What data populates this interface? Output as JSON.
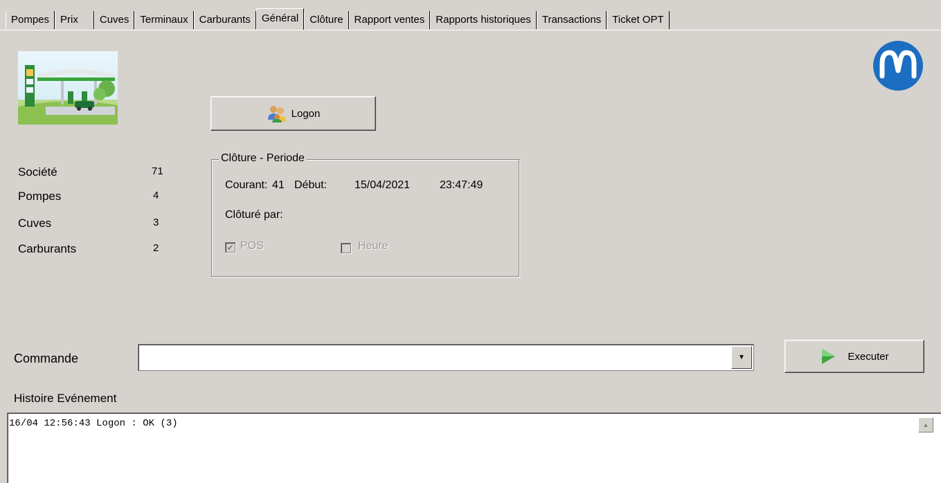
{
  "tabs": [
    {
      "label": "Pompes"
    },
    {
      "label": "Prix"
    },
    {
      "label": "Cuves"
    },
    {
      "label": "Terminaux"
    },
    {
      "label": "Carburants"
    },
    {
      "label": "Général",
      "active": true
    },
    {
      "label": "Clôture"
    },
    {
      "label": "Rapport ventes"
    },
    {
      "label": "Rapports historiques"
    },
    {
      "label": "Transactions"
    },
    {
      "label": "Ticket OPT"
    }
  ],
  "logon_label": "Logon",
  "stats": {
    "societe": {
      "label": "Société",
      "value": "71"
    },
    "pompes": {
      "label": "Pompes",
      "value": "4"
    },
    "cuves": {
      "label": "Cuves",
      "value": "3"
    },
    "carburants": {
      "label": "Carburants",
      "value": "2"
    }
  },
  "cloture": {
    "title": "Clôture - Periode",
    "courant_label": "Courant:",
    "courant_value": "41",
    "debut_label": "Début:",
    "debut_date": "15/04/2021",
    "debut_time": "23:47:49",
    "cloture_par_label": "Clôturé par:",
    "pos_label": "POS",
    "pos_checked": true,
    "heure_label": "Heure",
    "heure_checked": false
  },
  "commande": {
    "label": "Commande",
    "value": ""
  },
  "executer_label": "Executer",
  "history": {
    "label": "Histoire Evénement",
    "lines": [
      "16/04 12:56:43 Logon : OK (3)"
    ]
  },
  "colors": {
    "background": "#d6d3ce",
    "logo_blue": "#1b6ec2",
    "exec_arrow": "#3aa53a"
  }
}
